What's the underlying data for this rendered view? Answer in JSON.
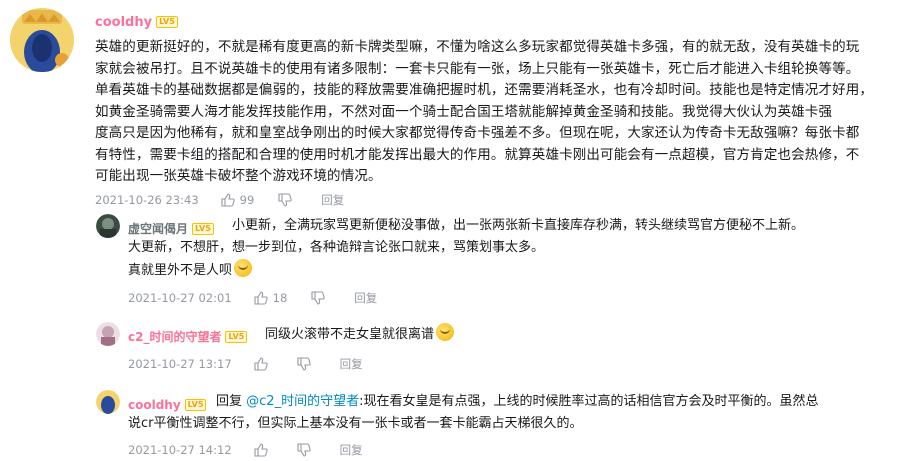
{
  "main_comment": {
    "username": "cooldhy",
    "level": "LV5",
    "lines": [
      "英雄的更新挺好的，不就是稀有度更高的新卡牌类型嘛，不懂为啥这么多玩家都觉得英雄卡多强，有的就无敌，没有英雄卡的玩",
      "家就会被吊打。且不说英雄卡的使用有诸多限制：一套卡只能有一张，场上只能有一张英雄卡，死亡后才能进入卡组轮换等等。",
      "单看英雄卡的基础数据都是偏弱的，技能的释放需要准确把握时机，还需要消耗圣水，也有冷却时间。技能也是特定情况才好用，",
      "如黄金圣骑需要人海才能发挥技能作用，不然对面一个骑士配合国王塔就能解掉黄金圣骑和技能。我觉得大伙认为英雄卡强",
      "度高只是因为他稀有，就和皇室战争刚出的时候大家都觉得传奇卡强差不多。但现在呢，大家还认为传奇卡无敌强嘛？每张卡都",
      "有特性，需要卡组的搭配和合理的使用时机才能发挥出最大的作用。就算英雄卡刚出可能会有一点超模，官方肯定也会热修，不",
      "可能出现一张英雄卡破坏整个游戏环境的情况。"
    ],
    "time": "2021-10-26 23:43",
    "likes": "99",
    "reply_label": "回复"
  },
  "replies": [
    {
      "username": "虚空闻偈月",
      "level": "LV5",
      "lines": [
        "小更新，全满玩家骂更新便秘没事做，出一张两张新卡直接库存秒满，转头继续骂官方便秘不上新。",
        "大更新，不想肝，想一步到位，各种诡辩言论张口就来，骂策划事太多。",
        "真就里外不是人呗"
      ],
      "time": "2021-10-27 02:01",
      "likes": "18",
      "reply_label": "回复"
    },
    {
      "username": "c2_时间的守望者",
      "level": "LV5",
      "text": "同级火滚带不走女皇就很离谱",
      "time": "2021-10-27 13:17",
      "likes": "",
      "reply_label": "回复"
    },
    {
      "username": "cooldhy",
      "level": "LV5",
      "prefix": "回复",
      "mention": "@c2_时间的守望者",
      "text_line1": ":现在看女皇是有点强，上线的时候胜率过高的话相信官方会及时平衡的。虽然总",
      "text_line2": "说cr平衡性调整不行，但实际上基本没有一张卡或者一套卡能霸占天梯很久的。",
      "time": "2021-10-27 14:12",
      "likes": "",
      "reply_label": "回复"
    }
  ]
}
